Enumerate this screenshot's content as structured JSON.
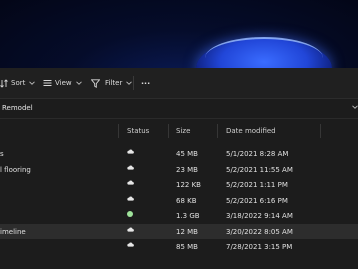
{
  "toolbar": {
    "sort_label": "Sort",
    "view_label": "View",
    "filter_label": "Filter",
    "more_label": "···"
  },
  "address": {
    "path": "Remodel"
  },
  "columns": {
    "status": "Status",
    "size": "Size",
    "date_modified": "Date modified"
  },
  "files": [
    {
      "name": "s",
      "status": "cloud-icon",
      "size": "45 MB",
      "date": "5/1/2021 8:28 AM",
      "selected": false
    },
    {
      "name": "l flooring",
      "status": "cloud-icon",
      "size": "23 MB",
      "date": "5/2/2021 11:55 AM",
      "selected": false
    },
    {
      "name": "",
      "status": "cloud-icon",
      "size": "122 KB",
      "date": "5/2/2021 1:11 PM",
      "selected": false
    },
    {
      "name": "",
      "status": "cloud-icon",
      "size": "68 KB",
      "date": "5/2/2021 6:16 PM",
      "selected": false
    },
    {
      "name": "",
      "status": "synced-icon",
      "size": "1.3 GB",
      "date": "3/18/2022 9:14 AM",
      "selected": false
    },
    {
      "name": "imeline",
      "status": "cloud-icon",
      "size": "12 MB",
      "date": "3/20/2022 8:05 AM",
      "selected": true
    },
    {
      "name": "",
      "status": "cloud-icon",
      "size": "85 MB",
      "date": "7/28/2021 3:15 PM",
      "selected": false
    }
  ],
  "colors": {
    "synced_status": "#9fe39b",
    "cloud_status": "#e6e6e6",
    "wallpaper_accent": "#2146d8"
  }
}
